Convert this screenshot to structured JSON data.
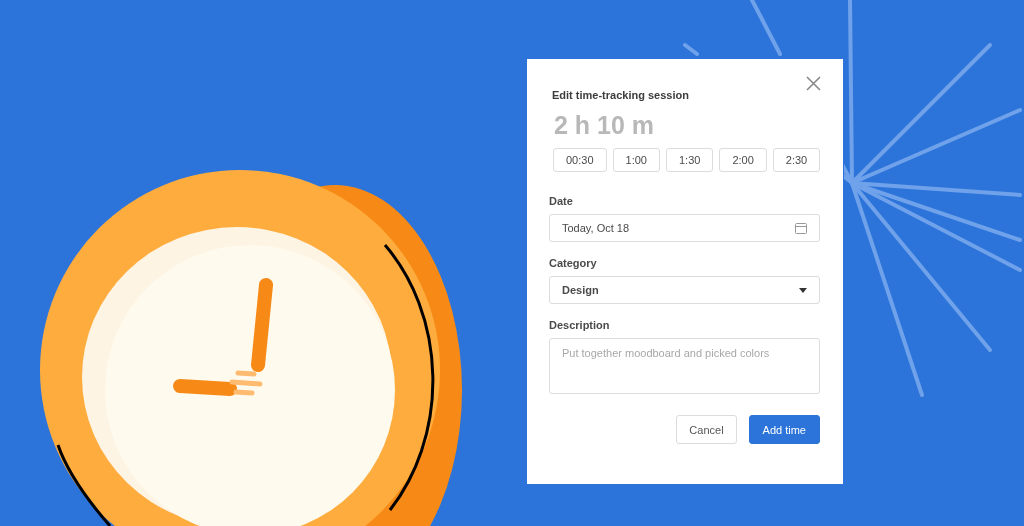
{
  "dialog": {
    "title": "Edit time-tracking session",
    "duration": "2 h 10 m",
    "presets": [
      "00:30",
      "1:00",
      "1:30",
      "2:00",
      "2:30"
    ],
    "date": {
      "label": "Date",
      "value": "Today, Oct 18"
    },
    "category": {
      "label": "Category",
      "value": "Design"
    },
    "description": {
      "label": "Description",
      "placeholder": "Put together moodboard and picked colors"
    },
    "buttons": [
      {
        "label": "Cancel",
        "kind": "secondary"
      },
      {
        "label": "Add time",
        "kind": "primary"
      }
    ]
  }
}
